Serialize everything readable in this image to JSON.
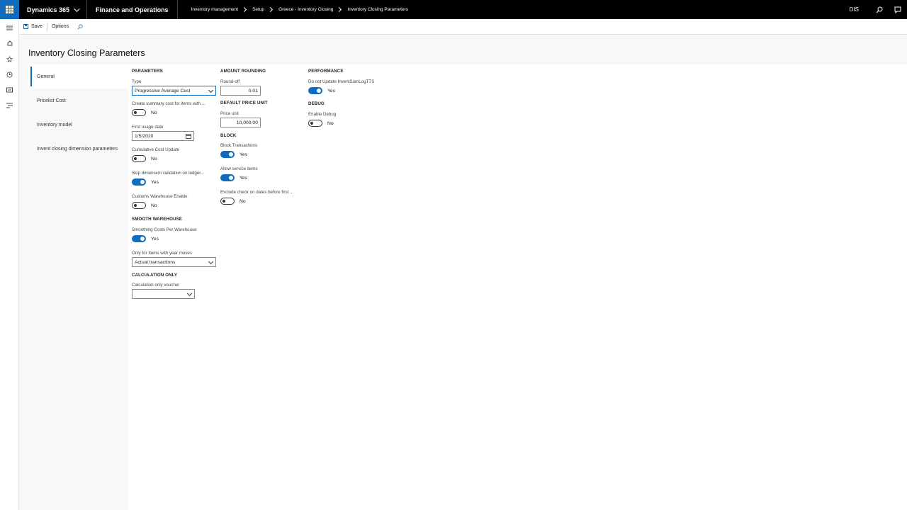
{
  "header": {
    "app_name": "Dynamics 365",
    "product": "Finance and Operations",
    "breadcrumbs": [
      "Inventory management",
      "Setup",
      "Greece - Inventory Closing",
      "Inventory Closing Parameters"
    ],
    "company": "DIS"
  },
  "actions": {
    "save": "Save",
    "options": "Options"
  },
  "page_title": "Inventory Closing Parameters",
  "tabs": [
    {
      "label": "General",
      "active": true
    },
    {
      "label": "Pricelist Cost",
      "active": false
    },
    {
      "label": "Inventory model",
      "active": false
    },
    {
      "label": "Invent closing dimension parameters",
      "active": false
    }
  ],
  "parameters": {
    "title": "PARAMETERS",
    "type_label": "Type",
    "type_value": "Progressive Average Cost",
    "summary_label": "Create summary cost for items with ...",
    "summary_value": "No",
    "first_usage_label": "First usage date",
    "first_usage_value": "1/5/2020",
    "cumulative_label": "Cumulative Cost Update",
    "cumulative_value": "No",
    "skip_label": "Skip dimension validation on ledger...",
    "skip_value": "Yes",
    "customs_label": "Customs Warehouse Enable",
    "customs_value": "No"
  },
  "smooth": {
    "title": "SMOOTH WAREHOUSE",
    "costs_label": "Smoothing Costs Per Warehouse",
    "costs_value": "Yes",
    "only_label": "Only for Items with year moves",
    "only_value": "Actual transactions"
  },
  "calc": {
    "title": "CALCULATION ONLY",
    "voucher_label": "Calculation only voucher",
    "voucher_value": ""
  },
  "rounding": {
    "title": "AMOUNT ROUNDING",
    "roundoff_label": "Round-off",
    "roundoff_value": "0.01"
  },
  "price_unit": {
    "title": "DEFAULT PRICE UNIT",
    "label": "Price unit",
    "value": "10,000.00"
  },
  "block": {
    "title": "BLOCK",
    "trans_label": "Block Transactions",
    "trans_value": "Yes",
    "service_label": "Allow service items",
    "service_value": "Yes",
    "exclude_label": "Exclude check on dates before first ...",
    "exclude_value": "No"
  },
  "performance": {
    "title": "PERFORMANCE",
    "label": "Do not Update InventSumLogTTS",
    "value": "Yes"
  },
  "debug": {
    "title": "DEBUG",
    "label": "Enable Debug",
    "value": "No"
  },
  "colors": {
    "accent": "#0f6cbd",
    "topbar": "#000000"
  },
  "icons": [
    "waffle-icon",
    "search-icon",
    "feedback-icon",
    "hamburger-icon",
    "home-icon",
    "star-icon",
    "clock-icon",
    "workspace-icon",
    "list-icon",
    "save-icon",
    "calendar-icon"
  ]
}
